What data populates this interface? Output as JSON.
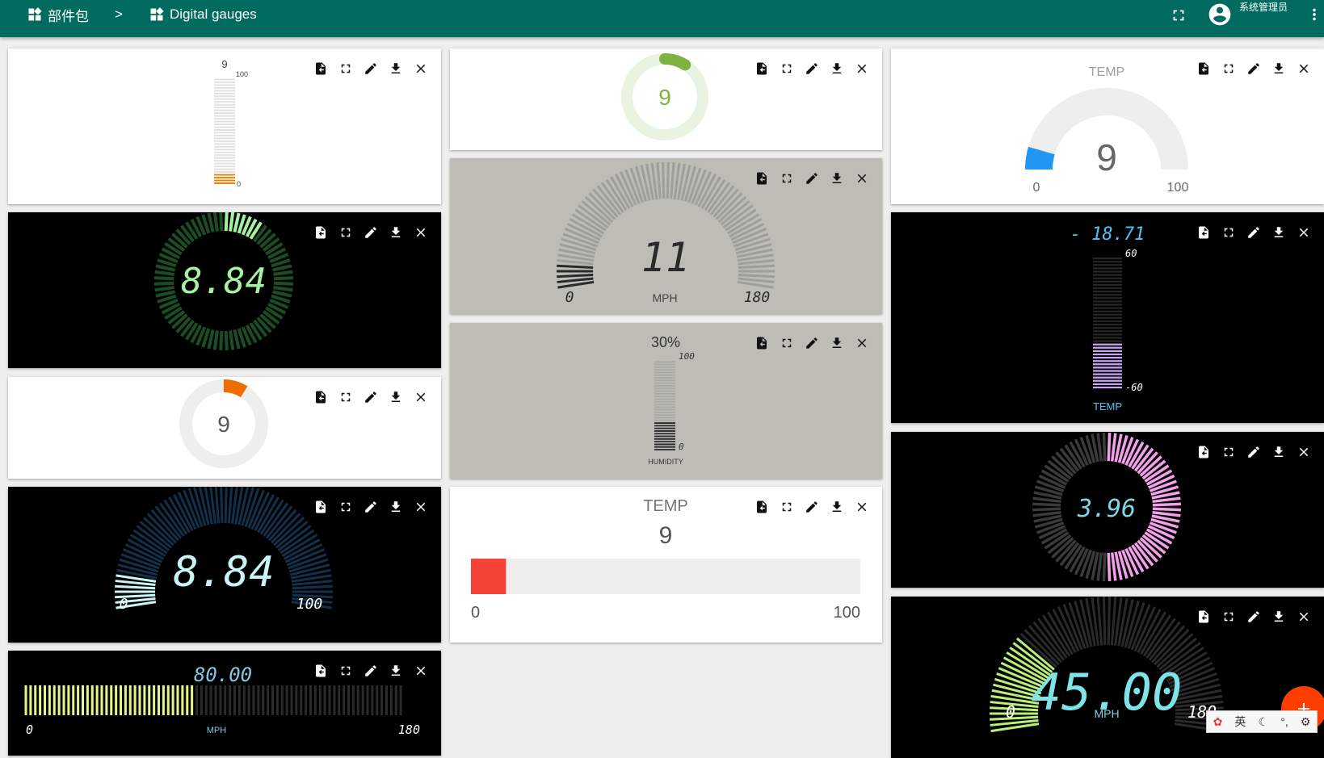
{
  "header": {
    "breadcrumb_root": "部件包",
    "separator": ">",
    "breadcrumb_current": "Digital gauges",
    "user_name": "系统管理员"
  },
  "icons": [
    "widgets-icon",
    "fullscreen-icon",
    "account-icon",
    "more-vert-icon",
    "export-icon",
    "fullscreen-icon",
    "edit-icon",
    "download-icon",
    "close-icon",
    "add-icon"
  ],
  "colors": {
    "header": "#006b5e",
    "fab": "#ff3d00"
  },
  "widgets": {
    "w1": {
      "value": "9",
      "max": "100",
      "min": "0",
      "fraction": 0.09
    },
    "w2": {
      "value": "8.84",
      "fraction": 0.0884
    },
    "w3": {
      "value": "9",
      "fraction": 0.09
    },
    "w4": {
      "value": "8.84",
      "min": "0",
      "max": "100",
      "fraction": 0.0884
    },
    "w5": {
      "value": "80.00",
      "min": "0",
      "max": "180",
      "label": "MPH",
      "fraction": 0.444
    },
    "w6": {
      "value": "9",
      "fraction": 0.09
    },
    "w7": {
      "value": "11",
      "min": "0",
      "max": "180",
      "label": "MPH",
      "fraction": 0.061
    },
    "w8": {
      "value": "30%",
      "max": "100",
      "min": "0",
      "label": "HUMIDITY",
      "fraction": 0.3
    },
    "w9": {
      "title": "TEMP",
      "value": "9",
      "min": "0",
      "max": "100",
      "fraction": 0.09
    },
    "w10": {
      "title": "TEMP",
      "value": "9",
      "min": "0",
      "max": "100",
      "fraction": 0.09
    },
    "w11": {
      "value": "- 18.71",
      "max": "60",
      "min": "-60",
      "label": "TEMP",
      "fraction": 0.344
    },
    "w12": {
      "value": "3.96",
      "fraction": 0.5
    },
    "w13": {
      "value": "45.00",
      "min": "0",
      "max": "180",
      "label": "MPH",
      "fraction": 0.25
    }
  },
  "ime": {
    "lang": "英"
  }
}
